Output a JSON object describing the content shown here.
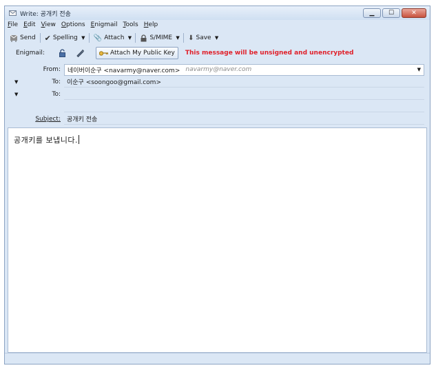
{
  "window": {
    "title": "Write: 공개키 전송",
    "icon": "compose-app-icon"
  },
  "menu": [
    "File",
    "Edit",
    "View",
    "Options",
    "Enigmail",
    "Tools",
    "Help"
  ],
  "toolbar": {
    "send": "Send",
    "spelling": "Spelling",
    "attach": "Attach",
    "smime": "S/MIME",
    "save": "Save"
  },
  "enigmail": {
    "label": "Enigmail:",
    "attach_key": "Attach My Public Key",
    "status": "This message will be unsigned and unencrypted",
    "status_color": "#e0202a"
  },
  "headers": {
    "from_label": "From:",
    "from_value": "네이버이순구 <navarmy@naver.com>",
    "from_hint": "navarmy@naver.com",
    "to_label": "To:",
    "to_value": "이순구 <soongoo@gmail.com>",
    "to2_label": "To:",
    "to2_value": "",
    "subject_label": "Subject:",
    "subject_value": "공개키 전송"
  },
  "body": {
    "text": "공개키를 보냅니다."
  }
}
